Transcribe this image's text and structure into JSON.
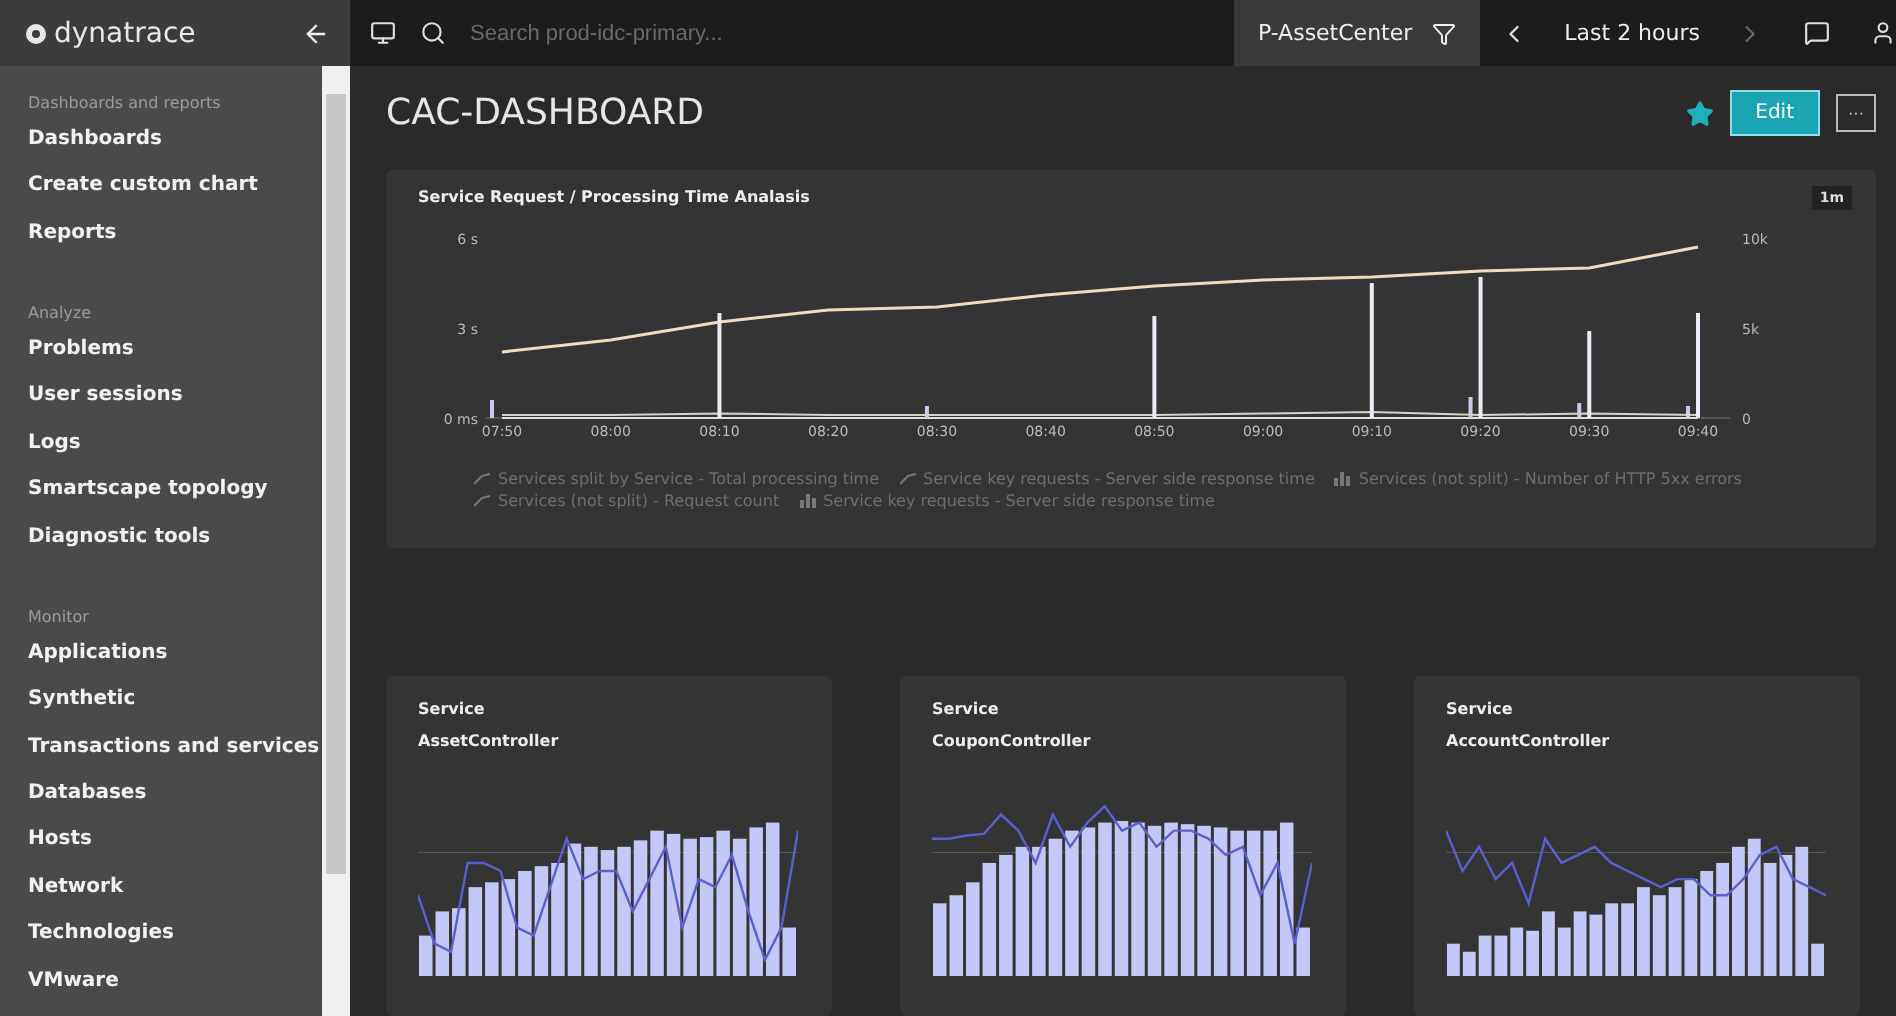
{
  "brand": {
    "name": "dynatrace"
  },
  "search": {
    "placeholder": "Search prod-idc-primary..."
  },
  "filter": {
    "label": "P-AssetCenter"
  },
  "timeframe": {
    "label": "Last 2 hours"
  },
  "sidebar": {
    "sections": [
      {
        "heading": "Dashboards and reports",
        "items": [
          "Dashboards",
          "Create custom chart",
          "Reports"
        ]
      },
      {
        "heading": "Analyze",
        "items": [
          "Problems",
          "User sessions",
          "Logs",
          "Smartscape topology",
          "Diagnostic tools"
        ]
      },
      {
        "heading": "Monitor",
        "items": [
          "Applications",
          "Synthetic",
          "Transactions and services",
          "Databases",
          "Hosts",
          "Network",
          "Technologies",
          "VMware"
        ]
      }
    ]
  },
  "dashboard": {
    "title": "CAC-DASHBOARD",
    "favorite": true,
    "edit_button": "Edit",
    "more_button": "···"
  },
  "main_chart": {
    "resolution": "1m",
    "chart_data": {
      "type": "line",
      "title": "Service Request / Processing Time Analasis",
      "categories": [
        "07:50",
        "08:00",
        "08:10",
        "08:20",
        "08:30",
        "08:40",
        "08:50",
        "09:00",
        "09:10",
        "09:20",
        "09:30",
        "09:40"
      ],
      "ylim": [
        0,
        6
      ],
      "yticks": [
        {
          "value": 0,
          "label": "0 ms"
        },
        {
          "value": 3,
          "label": "3 s"
        },
        {
          "value": 6,
          "label": "6 s"
        }
      ],
      "y2ticks": [
        "0",
        "5k",
        "10k"
      ],
      "series": [
        {
          "name": "Services split by Service - Total processing time",
          "type": "line",
          "color": "#f2dcc0",
          "values": [
            2.2,
            2.6,
            3.2,
            3.6,
            3.7,
            4.1,
            4.4,
            4.6,
            4.7,
            4.9,
            5.0,
            5.7
          ]
        },
        {
          "name": "Service key requests - Server side response time",
          "type": "line",
          "color": "#e6e0d8",
          "values": [
            0,
            0,
            0,
            0,
            0,
            0,
            0,
            0,
            0,
            0,
            0,
            0
          ]
        },
        {
          "name": "Services (not split) - Number of HTTP 5xx errors",
          "type": "bar",
          "color": "#c8c8f0",
          "values": [
            0.6,
            0,
            0,
            0,
            0.4,
            0,
            0,
            0,
            0,
            0.7,
            0.5,
            0.4
          ]
        },
        {
          "name": "Services (not split) - Request count",
          "type": "line",
          "color": "#d8d0c4",
          "values": [
            0.1,
            0.1,
            0.15,
            0.1,
            0.1,
            0.1,
            0.1,
            0.15,
            0.2,
            0.1,
            0.15,
            0.1
          ]
        },
        {
          "name": "Service key requests - Server side response time",
          "type": "bar",
          "color": "#ece8f4",
          "values": [
            0,
            0,
            3.5,
            0,
            0,
            0,
            3.4,
            0,
            4.5,
            4.7,
            2.9,
            3.5
          ]
        }
      ]
    }
  },
  "tiles": [
    {
      "label": "Service",
      "name": "AssetController"
    },
    {
      "label": "Service",
      "name": "CouponController"
    },
    {
      "label": "Service",
      "name": "AccountController"
    }
  ]
}
